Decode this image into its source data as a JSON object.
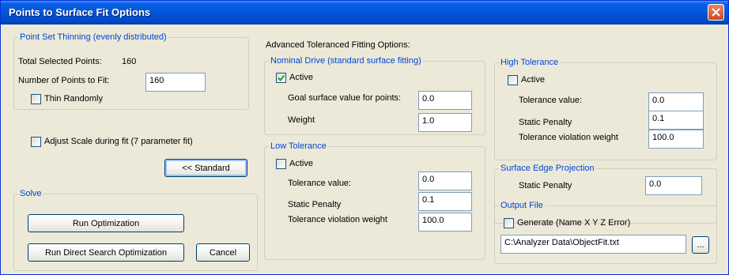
{
  "window": {
    "title": "Points to Surface Fit Options"
  },
  "thinning": {
    "legend": "Point Set Thinning (evenly distributed)",
    "total_label": "Total Selected Points:",
    "total_value": "160",
    "num_points_label": "Number of Points to Fit:",
    "num_points_value": "160",
    "thin_randomly_label": "Thin Randomly",
    "thin_randomly_checked": false
  },
  "adjust_scale": {
    "label": "Adjust Scale during fit (7 parameter fit)",
    "checked": false
  },
  "standard_button": "<< Standard",
  "solve": {
    "legend": "Solve",
    "run_optimization": "Run Optimization",
    "run_direct_search": "Run Direct Search Optimization",
    "cancel": "Cancel"
  },
  "advanced_heading": "Advanced Toleranced Fitting Options:",
  "nominal": {
    "legend": "Nominal Drive (standard surface fitting)",
    "active_label": "Active",
    "active_checked": true,
    "goal_label": "Goal surface value for points:",
    "goal_value": "0.0",
    "weight_label": "Weight",
    "weight_value": "1.0"
  },
  "low_tol": {
    "legend": "Low Tolerance",
    "active_label": "Active",
    "active_checked": false,
    "tol_label": "Tolerance value:",
    "tol_value": "0.0",
    "penalty_label": "Static Penalty",
    "penalty_value": "0.1",
    "violation_label": "Tolerance violation weight",
    "violation_value": "100.0"
  },
  "high_tol": {
    "legend": "High Tolerance",
    "active_label": "Active",
    "active_checked": false,
    "tol_label": "Tolerance value:",
    "tol_value": "0.0",
    "penalty_label": "Static Penalty",
    "penalty_value": "0.1",
    "violation_label": "Tolerance violation weight",
    "violation_value": "100.0"
  },
  "edge": {
    "legend": "Surface Edge Projection",
    "penalty_label": "Static Penalty",
    "penalty_value": "0.0"
  },
  "output": {
    "legend": "Output File",
    "generate_label": "Generate (Name X Y Z Error)",
    "generate_checked": false,
    "path_value": "C:\\Analyzer Data\\ObjectFit.txt",
    "browse_label": "..."
  },
  "colors": {
    "title_bar": "#0355d8",
    "group_legend": "#0046d5",
    "dialog_bg": "#ece9d8",
    "close_button": "#d1471f"
  }
}
